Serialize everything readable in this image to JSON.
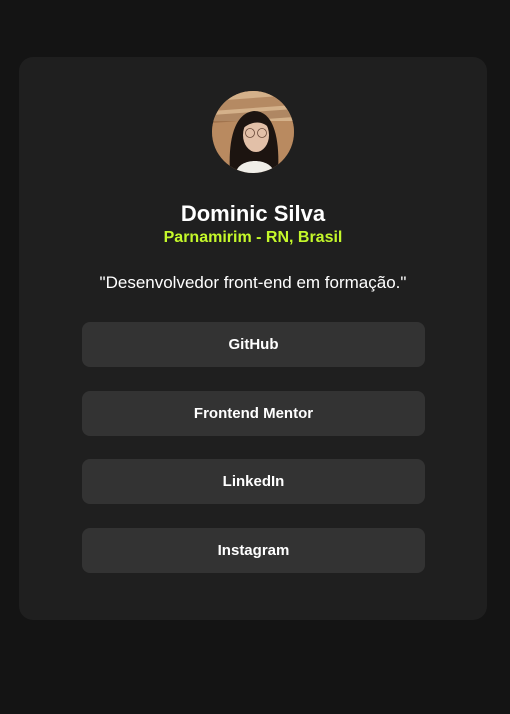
{
  "profile": {
    "name": "Dominic Silva",
    "location": "Parnamirim - RN, Brasil",
    "bio": "\"Desenvolvedor front-end em formação.\"",
    "avatar_icon": "profile-photo"
  },
  "links": [
    {
      "label": "GitHub"
    },
    {
      "label": "Frontend Mentor"
    },
    {
      "label": "LinkedIn"
    },
    {
      "label": "Instagram"
    }
  ],
  "colors": {
    "background": "#141414",
    "card": "#1f1f1f",
    "button": "#333333",
    "accent": "#c4f82a",
    "text": "#ffffff"
  }
}
